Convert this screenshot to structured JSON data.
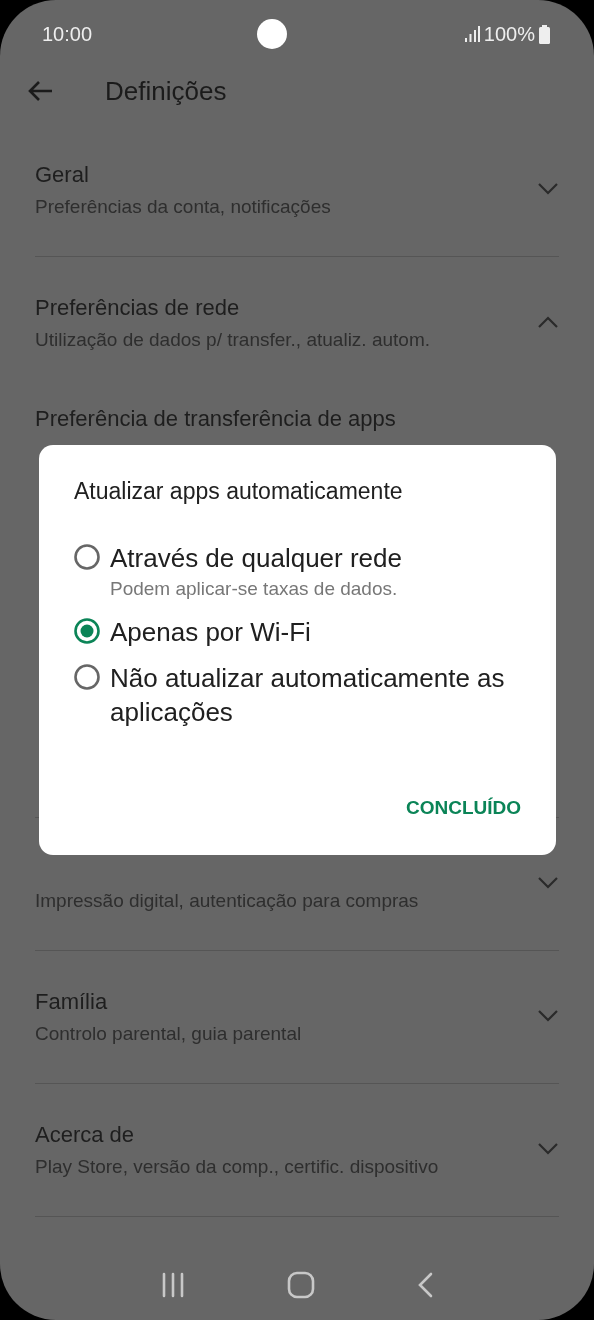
{
  "status_bar": {
    "time": "10:00",
    "battery": "100%"
  },
  "app_bar": {
    "title": "Definições"
  },
  "sections": [
    {
      "title": "Geral",
      "subtitle": "Preferências da conta, notificações",
      "expanded": false
    },
    {
      "title": "Preferências de rede",
      "subtitle": "Utilização de dados p/ transfer., atualiz. autom.",
      "expanded": true,
      "children": [
        {
          "title": "Preferência de transferência de apps"
        }
      ]
    },
    {
      "subtitle": "Impressão digital, autenticação para compras",
      "expanded": false
    },
    {
      "title": "Família",
      "subtitle": "Controlo parental, guia parental",
      "expanded": false
    },
    {
      "title": "Acerca de",
      "subtitle": "Play Store, versão da comp., certific. dispositivo",
      "expanded": false
    }
  ],
  "dialog": {
    "title": "Atualizar apps automaticamente",
    "options": [
      {
        "label": "Através de qualquer rede",
        "note": "Podem aplicar-se taxas de dados.",
        "selected": false
      },
      {
        "label": "Apenas por Wi-Fi",
        "selected": true
      },
      {
        "label": "Não atualizar automaticamente as aplicações",
        "selected": false
      }
    ],
    "button": "CONCLUÍDO"
  }
}
